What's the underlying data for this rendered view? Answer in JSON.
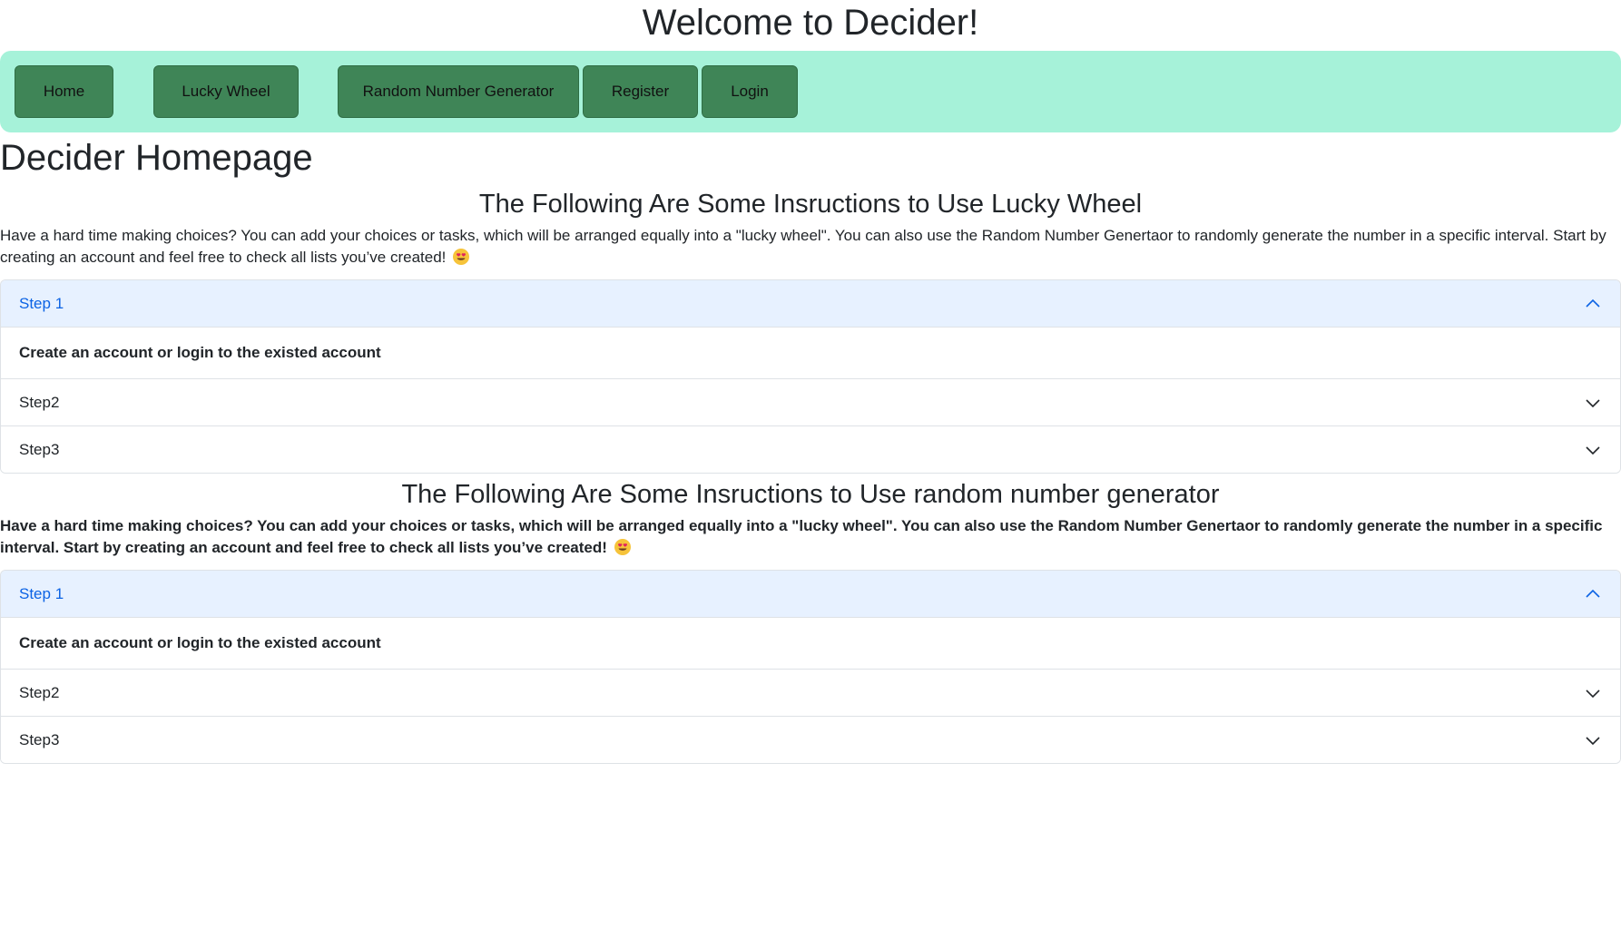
{
  "site": {
    "title": "Welcome to Decider!"
  },
  "nav": {
    "home": "Home",
    "lucky_wheel": "Lucky Wheel",
    "random_number_generator": "Random Number Generator",
    "register": "Register",
    "login": "Login",
    "background_color": "#a6f2d9",
    "button_color": "#3f8557"
  },
  "main": {
    "heading": "Decider Homepage"
  },
  "sections": [
    {
      "title": "The Following Are Some Insructions to Use Lucky Wheel",
      "description": "Have a hard time making choices? You can add your choices or tasks, which will be arranged equally into a \"lucky wheel\". You can also use the Random Number Genertaor to randomly generate the number in a specific interval. Start by creating an account and feel free to check all lists you’ve created!",
      "emoji_icon": "heart-eyes-emoji-icon",
      "accordion": {
        "step1_label": "Step 1",
        "step1_body": "Create an account or login to the existed account",
        "step2_label": "Step2",
        "step3_label": "Step3"
      }
    },
    {
      "title": "The Following Are Some Insructions to Use random number generator",
      "description": "Have a hard time making choices? You can add your choices or tasks, which will be arranged equally into a \"lucky wheel\". You can also use the Random Number Genertaor to randomly generate the number in a specific interval. Start by creating an account and feel free to check all lists you’ve created!",
      "emoji_icon": "heart-eyes-emoji-icon",
      "accordion": {
        "step1_label": "Step 1",
        "step1_body": "Create an account or login to the existed account",
        "step2_label": "Step2",
        "step3_label": "Step3"
      }
    }
  ],
  "colors": {
    "accordion_open_bg": "#e7f1ff",
    "accordion_open_text": "#0c63e4"
  },
  "icons": {
    "chevron_up": "chevron-up-icon",
    "chevron_down": "chevron-down-icon"
  }
}
